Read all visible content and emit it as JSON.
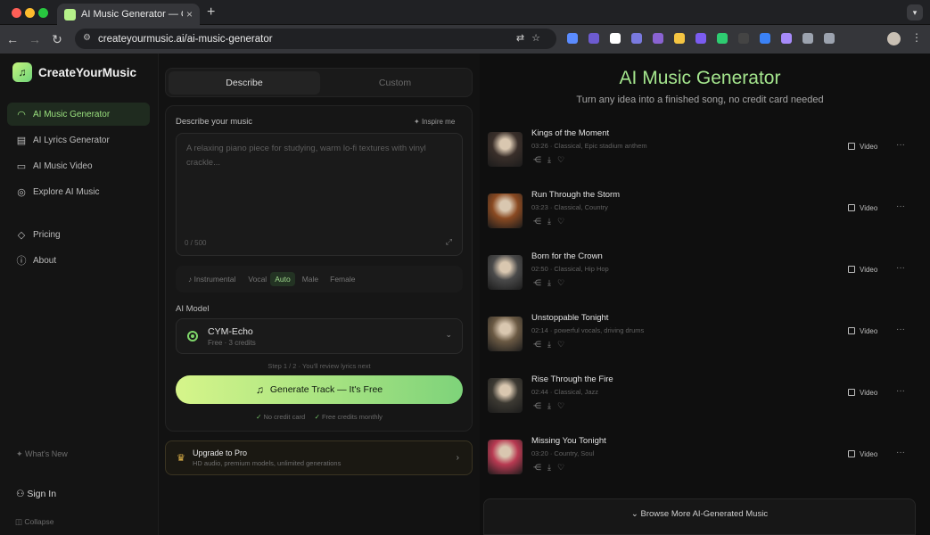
{
  "browser": {
    "tab_title": "AI Music Generator — Create",
    "tab_close": "×",
    "new_tab": "+",
    "url": "createyourmusic.ai/ai-music-generator",
    "extension_colors": [
      "#5b8cff",
      "#6d5bd0",
      "#ffffff",
      "#7a7adf",
      "#8a63d2",
      "#f5c542",
      "#7b5cf0",
      "#2ecc71",
      "#444444",
      "#3b82f6",
      "#a78bfa",
      "#9ca3af",
      "#9ca3af"
    ]
  },
  "sidebar": {
    "brand": "CreateYourMusic",
    "items": [
      {
        "label": "AI Music Generator",
        "icon": "headphones-icon",
        "active": true
      },
      {
        "label": "AI Lyrics Generator",
        "icon": "document-icon",
        "active": false
      },
      {
        "label": "AI Music Video",
        "icon": "video-icon",
        "active": false
      },
      {
        "label": "Explore AI Music",
        "icon": "compass-icon",
        "active": false
      },
      {
        "label": "Pricing",
        "icon": "diamond-icon",
        "active": false
      },
      {
        "label": "About",
        "icon": "info-icon",
        "active": false
      }
    ],
    "whats_new": "What's New",
    "sign_in": "Sign In",
    "collapse": "Collapse"
  },
  "composer": {
    "tabs": [
      "Describe",
      "Custom"
    ],
    "describe_label": "Describe your music",
    "inspire": "Inspire me",
    "placeholder": "A relaxing piano piece for studying, warm lo-fi textures with vinyl crackle...",
    "counter": "0 / 500",
    "instrumental": "Instrumental",
    "vocal_label": "Vocal",
    "vocal_options": [
      "Auto",
      "Male",
      "Female"
    ],
    "vocal_selected": "Auto",
    "model_label": "AI Model",
    "model_name": "CYM-Echo",
    "model_sub": "Free · 3 credits",
    "step": "Step 1 / 2 · You'll review lyrics next",
    "generate": "Generate Track — It's Free",
    "check1": "No credit card",
    "check2": "Free credits monthly"
  },
  "upgrade": {
    "title": "Upgrade to Pro",
    "subtitle": "HD audio, premium models, unlimited generations"
  },
  "showcase": {
    "title": "AI Music Generator",
    "subtitle": "Turn any idea into a finished song, no credit card needed",
    "video_label": "Video",
    "tracks": [
      {
        "title": "Kings of the Moment",
        "meta": "03:26 · Classical, Epic stadium anthem",
        "color": "#3a2f2a"
      },
      {
        "title": "Run Through the Storm",
        "meta": "03:23 · Classical, Country",
        "color": "#8a4a22"
      },
      {
        "title": "Born for the Crown",
        "meta": "02:50 · Classical, Hip Hop",
        "color": "#4a4a4a"
      },
      {
        "title": "Unstoppable Tonight",
        "meta": "02:14 · powerful vocals, driving drums",
        "color": "#6b5a44"
      },
      {
        "title": "Rise Through the Fire",
        "meta": "02:44 · Classical, Jazz",
        "color": "#3d3a33"
      },
      {
        "title": "Missing You Tonight",
        "meta": "03:20 · Country, Soul",
        "color": "#b83a52"
      }
    ],
    "browse": "Browse More AI-Generated Music"
  }
}
